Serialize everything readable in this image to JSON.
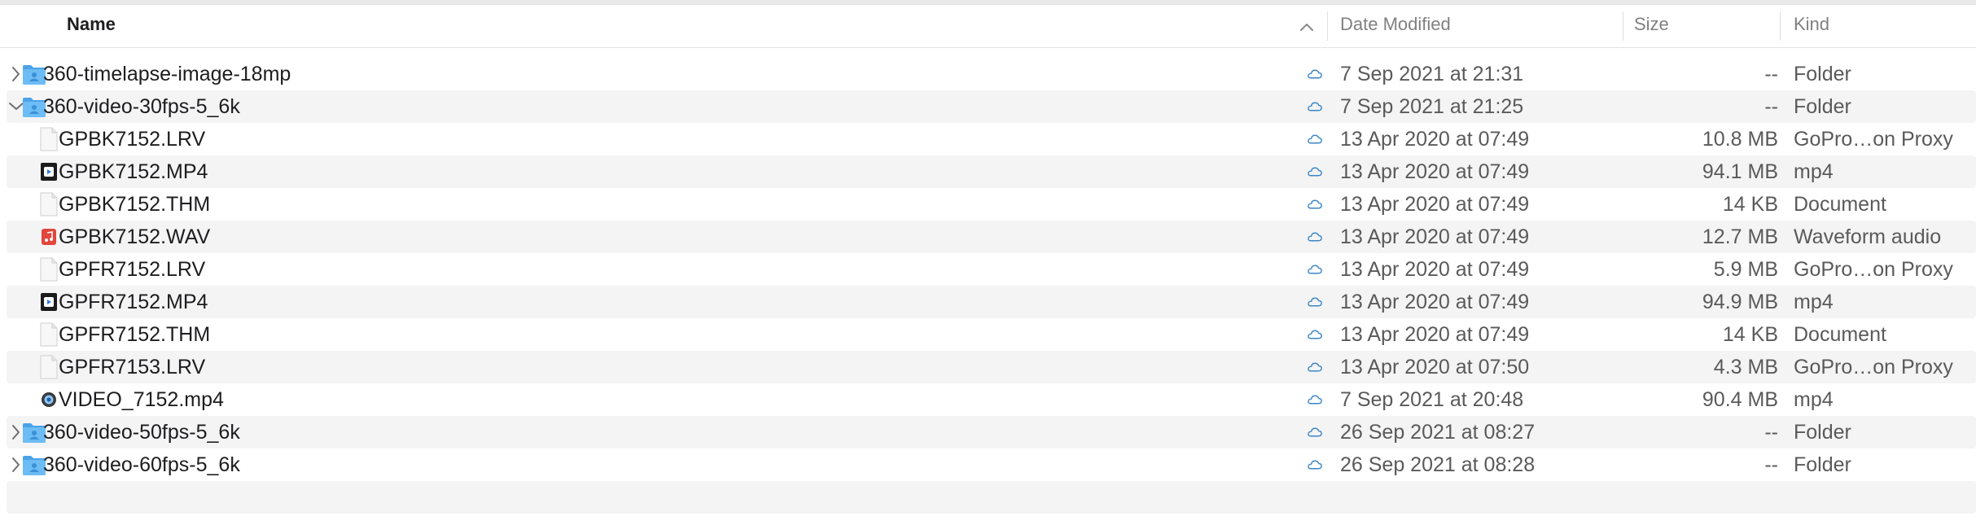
{
  "columns": {
    "name": "Name",
    "date_modified": "Date Modified",
    "size": "Size",
    "kind": "Kind"
  },
  "sort": {
    "column": "Name",
    "direction": "ascending",
    "icon": "chevron-up-icon"
  },
  "colors": {
    "folder_blue": "#5fb3f0",
    "alt_row": "#f4f4f5",
    "text_primary": "#1d1d1f",
    "text_secondary": "#5a5a5a",
    "cloud_icon": "#3a86c8",
    "audio_red": "#e2463c",
    "video_dark": "#1b1b1b"
  },
  "rows": [
    {
      "name": "360-timelapse-image-18mp",
      "date": "7 Sep 2021 at 21:31",
      "size": "--",
      "kind": "Folder",
      "icon": "folder-icon",
      "level": 0,
      "expandable": true,
      "expanded": false,
      "cloud": true
    },
    {
      "name": "360-video-30fps-5_6k",
      "date": "7 Sep 2021 at 21:25",
      "size": "--",
      "kind": "Folder",
      "icon": "folder-icon",
      "level": 0,
      "expandable": true,
      "expanded": true,
      "cloud": true
    },
    {
      "name": "GPBK7152.LRV",
      "date": "13 Apr 2020 at 07:49",
      "size": "10.8 MB",
      "kind": "GoPro…on Proxy",
      "icon": "document-icon",
      "level": 1,
      "expandable": false,
      "cloud": true
    },
    {
      "name": "GPBK7152.MP4",
      "date": "13 Apr 2020 at 07:49",
      "size": "94.1 MB",
      "kind": "mp4",
      "icon": "video-file-icon",
      "level": 1,
      "expandable": false,
      "cloud": true
    },
    {
      "name": "GPBK7152.THM",
      "date": "13 Apr 2020 at 07:49",
      "size": "14 KB",
      "kind": "Document",
      "icon": "document-icon",
      "level": 1,
      "expandable": false,
      "cloud": true
    },
    {
      "name": "GPBK7152.WAV",
      "date": "13 Apr 2020 at 07:49",
      "size": "12.7 MB",
      "kind": "Waveform audio",
      "icon": "audio-file-icon",
      "level": 1,
      "expandable": false,
      "cloud": true
    },
    {
      "name": "GPFR7152.LRV",
      "date": "13 Apr 2020 at 07:49",
      "size": "5.9 MB",
      "kind": "GoPro…on Proxy",
      "icon": "document-icon",
      "level": 1,
      "expandable": false,
      "cloud": true
    },
    {
      "name": "GPFR7152.MP4",
      "date": "13 Apr 2020 at 07:49",
      "size": "94.9 MB",
      "kind": "mp4",
      "icon": "video-file-icon",
      "level": 1,
      "expandable": false,
      "cloud": true
    },
    {
      "name": "GPFR7152.THM",
      "date": "13 Apr 2020 at 07:49",
      "size": "14 KB",
      "kind": "Document",
      "icon": "document-icon",
      "level": 1,
      "expandable": false,
      "cloud": true
    },
    {
      "name": "GPFR7153.LRV",
      "date": "13 Apr 2020 at 07:50",
      "size": "4.3 MB",
      "kind": "GoPro…on Proxy",
      "icon": "document-icon",
      "level": 1,
      "expandable": false,
      "cloud": true
    },
    {
      "name": "VIDEO_7152.mp4",
      "date": "7 Sep 2021 at 20:48",
      "size": "90.4 MB",
      "kind": "mp4",
      "icon": "quicktime-file-icon",
      "level": 1,
      "expandable": false,
      "cloud": true
    },
    {
      "name": "360-video-50fps-5_6k",
      "date": "26 Sep 2021 at 08:27",
      "size": "--",
      "kind": "Folder",
      "icon": "folder-icon",
      "level": 0,
      "expandable": true,
      "expanded": false,
      "cloud": true
    },
    {
      "name": "360-video-60fps-5_6k",
      "date": "26 Sep 2021 at 08:28",
      "size": "--",
      "kind": "Folder",
      "icon": "folder-icon",
      "level": 0,
      "expandable": true,
      "expanded": false,
      "cloud": true
    }
  ]
}
